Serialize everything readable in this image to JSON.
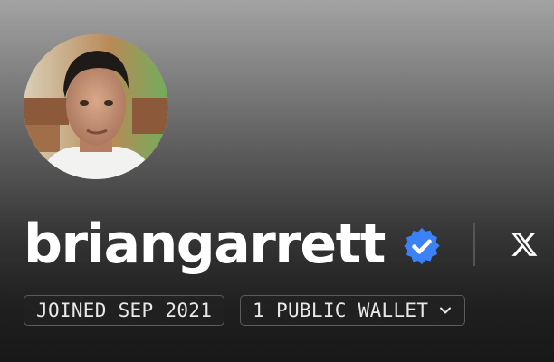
{
  "profile": {
    "username": "briangarrett",
    "verified": true,
    "verified_color": "#3b82f6",
    "avatar_icon": "profile-photo",
    "social_icon": "x-logo-icon"
  },
  "badges": {
    "joined": "JOINED SEP 2021",
    "wallets": "1 PUBLIC WALLET",
    "wallets_icon": "chevron-down-icon"
  }
}
